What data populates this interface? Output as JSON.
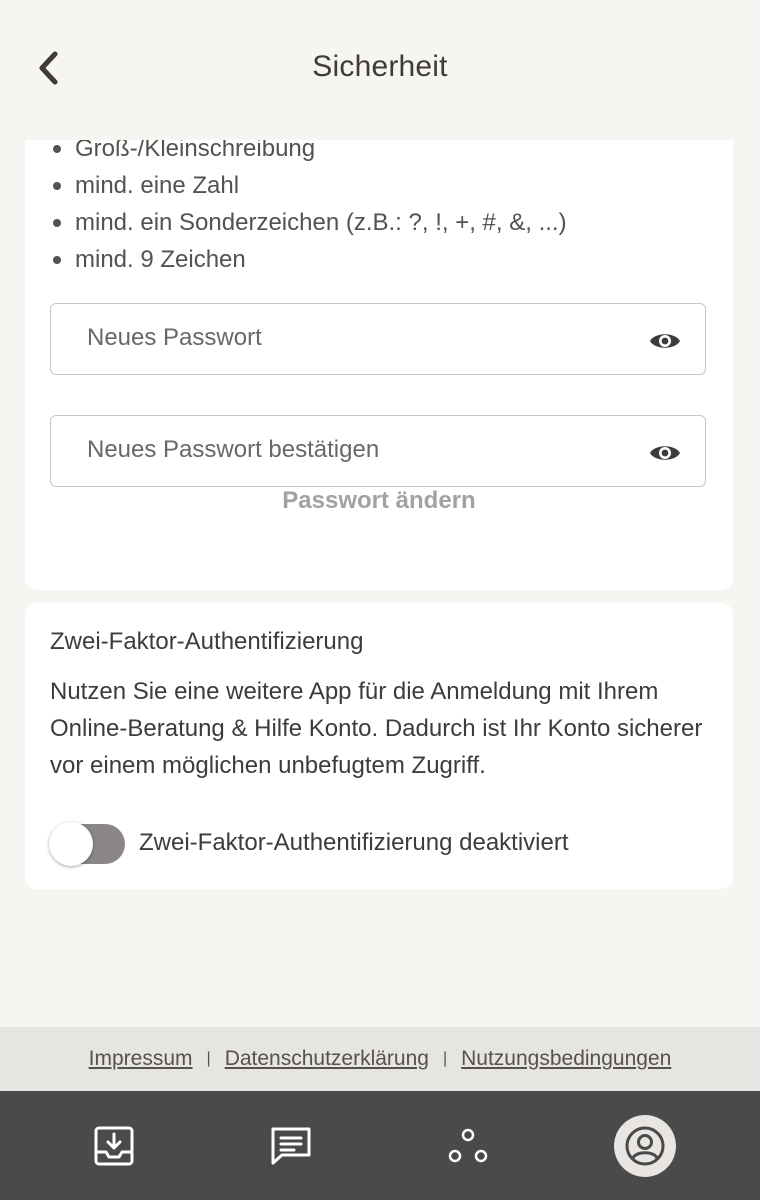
{
  "header": {
    "title": "Sicherheit",
    "back_icon": "chevron-left-icon"
  },
  "password": {
    "rules": [
      "Groß-/Kleinschreibung",
      "mind. eine Zahl",
      "mind. ein Sonderzeichen (z.B.: ?, !, +, #, &, ...)",
      "mind. 9 Zeichen"
    ],
    "new_placeholder": "Neues Passwort",
    "confirm_placeholder": "Neues Passwort bestätigen",
    "new_value": "",
    "confirm_value": "",
    "change_label": "Passwort ändern"
  },
  "two_factor": {
    "title": "Zwei-Faktor-Authentifizierung",
    "description": "Nutzen Sie eine weitere App für die Anmeldung mit Ihrem Online-Beratung & Hilfe Konto. Dadurch ist Ihr Konto sicherer vor einem möglichen unbefugtem Zugriff.",
    "toggle_label": "Zwei-Faktor-Authentifizierung deaktiviert",
    "enabled": false
  },
  "footer": {
    "links": [
      "Impressum",
      "Datenschutzerklärung",
      "Nutzungsbedingungen"
    ],
    "separator": "|"
  },
  "nav": {
    "items": [
      {
        "icon": "inbox-icon",
        "active": false
      },
      {
        "icon": "messages-icon",
        "active": false
      },
      {
        "icon": "team-icon",
        "active": false
      },
      {
        "icon": "profile-icon",
        "active": true
      }
    ]
  },
  "colors": {
    "background": "#f7f5f1",
    "card": "#ffffff",
    "text": "#3e3b39",
    "muted_button": "#a4a19e",
    "toggle_off": "#8a8688",
    "footer_bg": "#e7e5e2",
    "nav_bg": "#4a4a4a"
  }
}
